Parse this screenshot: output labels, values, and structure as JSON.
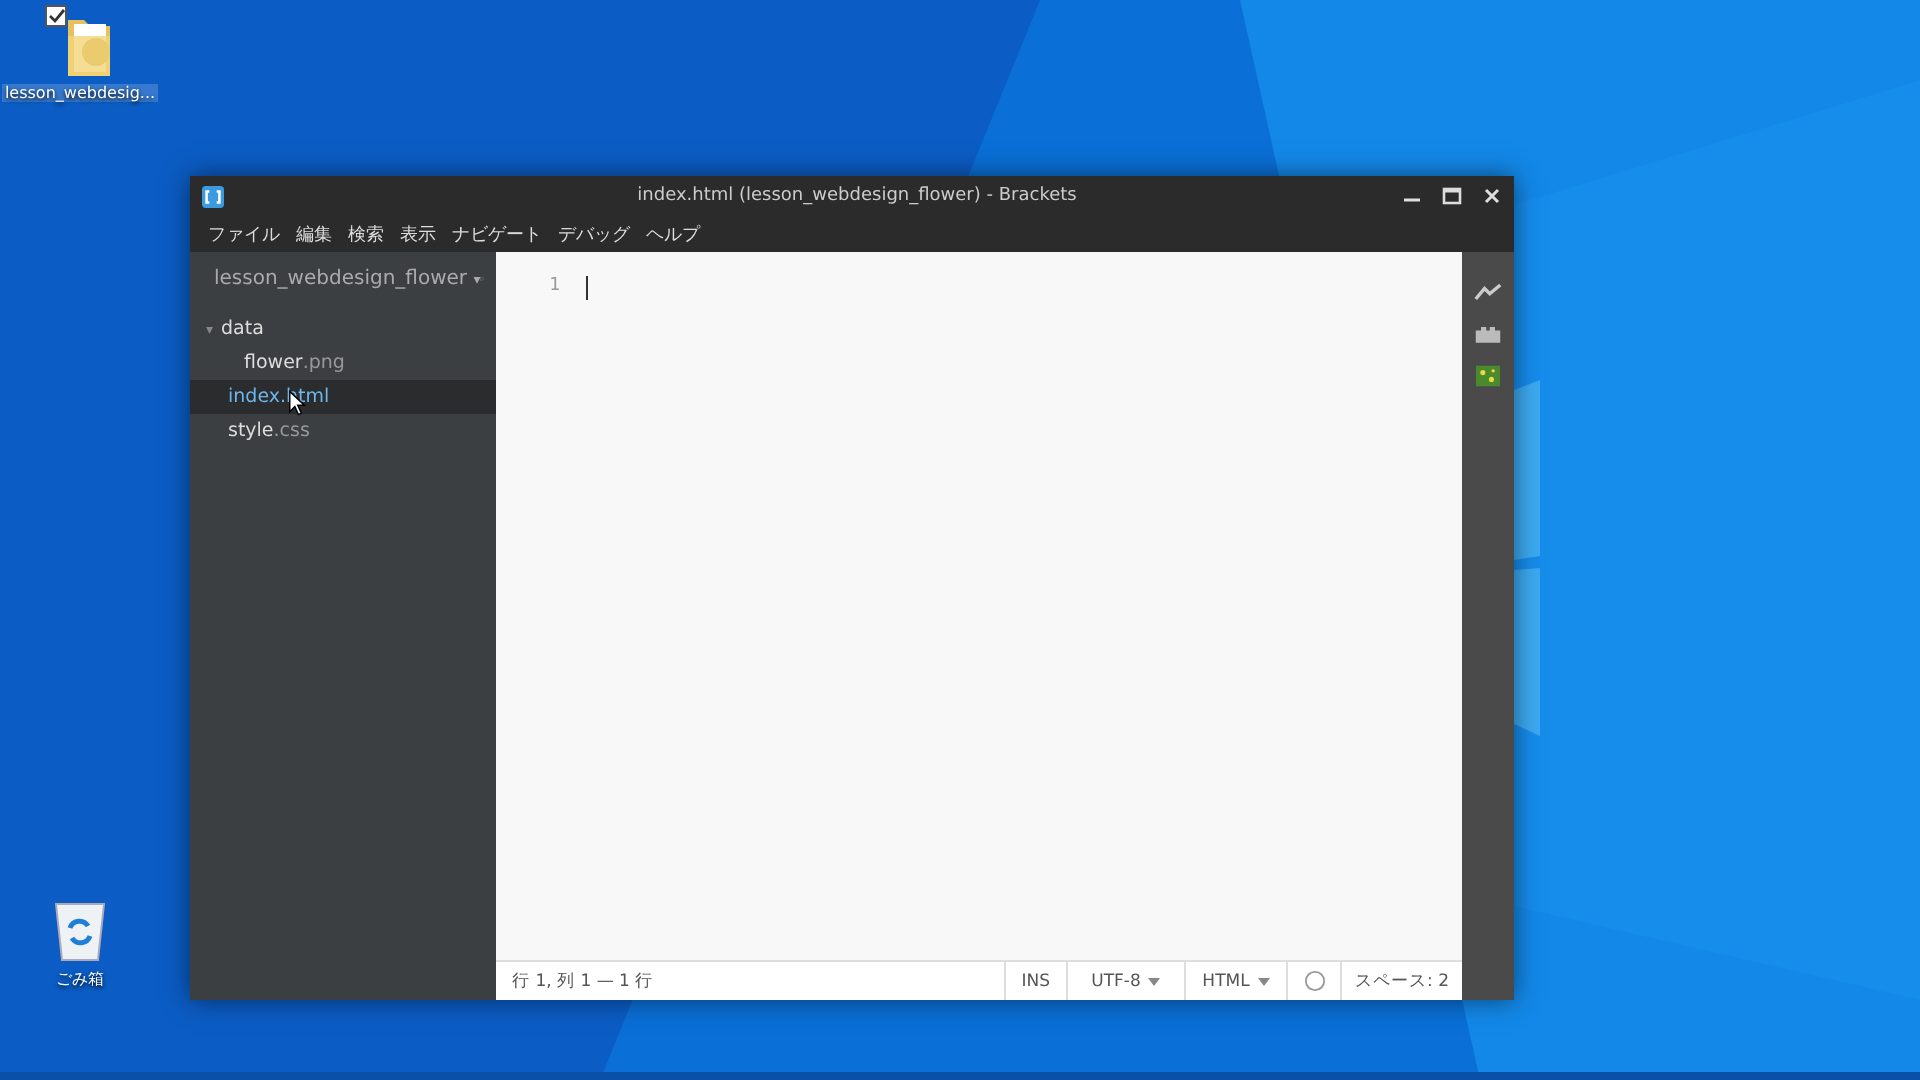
{
  "desktop": {
    "icons": [
      {
        "label": "lesson_webdesig...",
        "kind": "folder",
        "selected": true
      },
      {
        "label": "ごみ箱",
        "kind": "recycle",
        "selected": false
      }
    ]
  },
  "window": {
    "title": "index.html (lesson_webdesign_flower) - Brackets"
  },
  "menu": [
    "ファイル",
    "編集",
    "検索",
    "表示",
    "ナビゲート",
    "デバッグ",
    "ヘルプ"
  ],
  "sidebar": {
    "project": "lesson_webdesign_flower",
    "arrow": "▾",
    "tree": [
      {
        "name": "data",
        "kind": "folder",
        "expanded": true,
        "selected": false,
        "children": [
          {
            "name": "flower",
            "ext": ".png",
            "kind": "file",
            "selected": false
          }
        ]
      },
      {
        "name": "index",
        "ext": ".html",
        "kind": "file",
        "selected": true
      },
      {
        "name": "style",
        "ext": ".css",
        "kind": "file",
        "selected": false
      }
    ]
  },
  "editor": {
    "line_numbers": [
      "1"
    ]
  },
  "status_bar": {
    "position": "行 1, 列 1 — 1 行",
    "mode": "INS",
    "encoding": "UTF-8",
    "language": "HTML",
    "indent": "スペース: 2"
  }
}
